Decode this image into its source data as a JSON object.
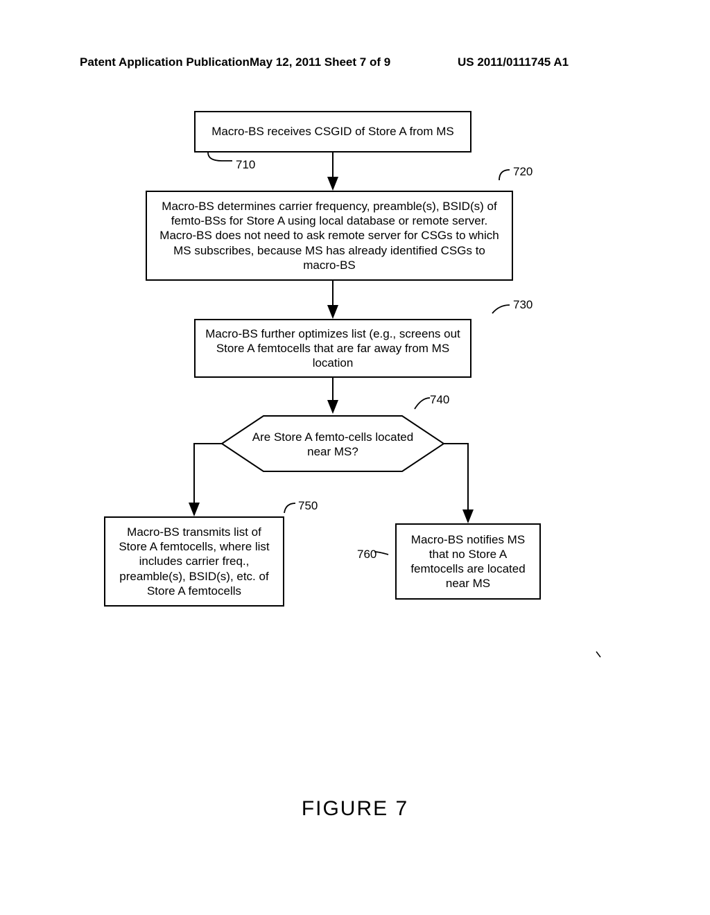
{
  "header": {
    "left": "Patent Application Publication",
    "middle": "May 12, 2011  Sheet 7 of 9",
    "right": "US 2011/0111745 A1"
  },
  "boxes": {
    "b710": "Macro-BS receives CSGID of Store A from MS",
    "b720": "Macro-BS determines carrier frequency, preamble(s), BSID(s) of femto-BSs for Store A using local database or remote server.  Macro-BS does not need to ask remote server for CSGs to which MS subscribes, because MS has already identified CSGs to macro-BS",
    "b730": "Macro-BS further optimizes list (e.g., screens out Store A femtocells that are far away from MS location",
    "b740": "Are Store A femto-cells located near MS?",
    "b750": "Macro-BS transmits list of Store A femtocells, where list includes carrier freq., preamble(s), BSID(s), etc. of Store A femtocells",
    "b760": "Macro-BS notifies MS that no Store A femtocells are located near MS"
  },
  "refs": {
    "r710": "710",
    "r720": "720",
    "r730": "730",
    "r740": "740",
    "r750": "750",
    "r760": "760"
  },
  "figure_label": "FIGURE 7"
}
